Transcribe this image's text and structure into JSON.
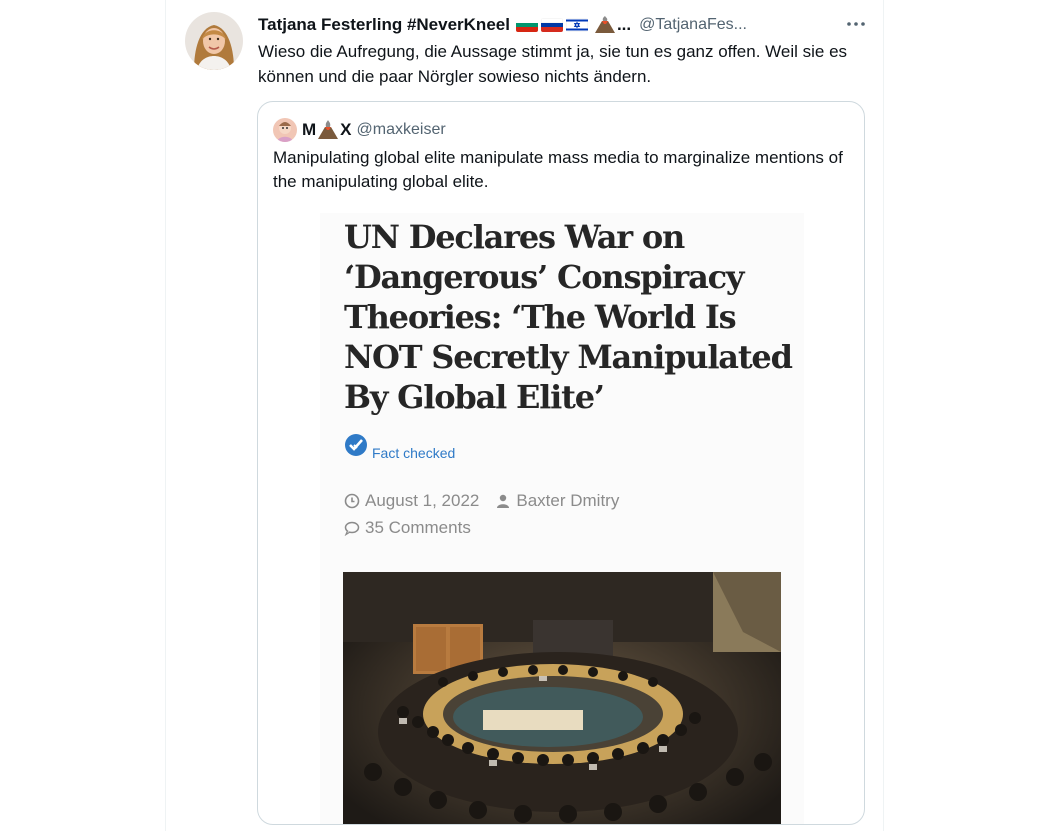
{
  "tweet": {
    "author_name": "Tatjana Festerling #NeverKneel",
    "name_overflow": "...",
    "handle": "@TatjanaFes...",
    "text": "Wieso die Aufregung, die Aussage stimmt ja, sie tun es ganz offen. Weil sie es können und die paar Nörgler sowieso nichts ändern.",
    "flags": [
      "bulgaria-flag",
      "russia-flag",
      "israel-flag"
    ],
    "more_icon": "more-horizontal-icon"
  },
  "quote": {
    "name_first": "M",
    "name_last": "X",
    "handle": "@maxkeiser",
    "text": "Manipulating global elite manipulate mass media to marginalize mentions of the manipulating global elite."
  },
  "article": {
    "headline": "UN Declares War on ‘Dangerous’ Conspiracy Theories: ‘The World Is NOT Secretly Manipulated By Global Elite’",
    "fact_checked": "Fact checked",
    "date": "August 1, 2022",
    "author": "Baxter Dmitry",
    "comments": "35 Comments"
  },
  "colors": {
    "text": "#0f1419",
    "secondary": "#536471",
    "border": "#cfd9de",
    "fact_blue": "#2f7ac7",
    "meta_gray": "#8b8b8b"
  }
}
